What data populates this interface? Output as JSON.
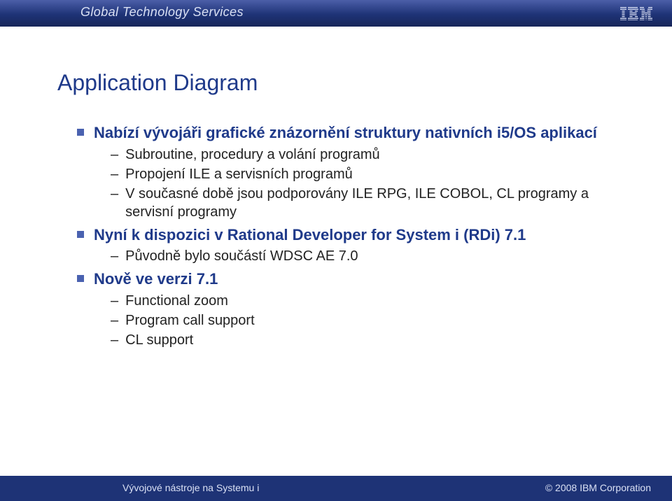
{
  "header": {
    "subtitle": "Global Technology Services"
  },
  "title": "Application Diagram",
  "bullets": [
    {
      "text": "Nabízí vývojáři grafické znázornění struktury nativních i5/OS aplikací",
      "children": [
        "Subroutine, procedury a volání programů",
        "Propojení ILE a servisních programů",
        "V současné době jsou podporovány ILE RPG, ILE COBOL, CL programy a servisní programy"
      ]
    },
    {
      "text": "Nyní k dispozici v Rational Developer for System i (RDi) 7.1",
      "children": [
        "Původně bylo součástí WDSC AE 7.0"
      ]
    },
    {
      "text": "Nově ve verzi 7.1",
      "children": [
        "Functional zoom",
        "Program call support",
        "CL support"
      ]
    }
  ],
  "footer": {
    "left": "Vývojové nástroje na Systemu i",
    "right": "© 2008 IBM Corporation"
  }
}
